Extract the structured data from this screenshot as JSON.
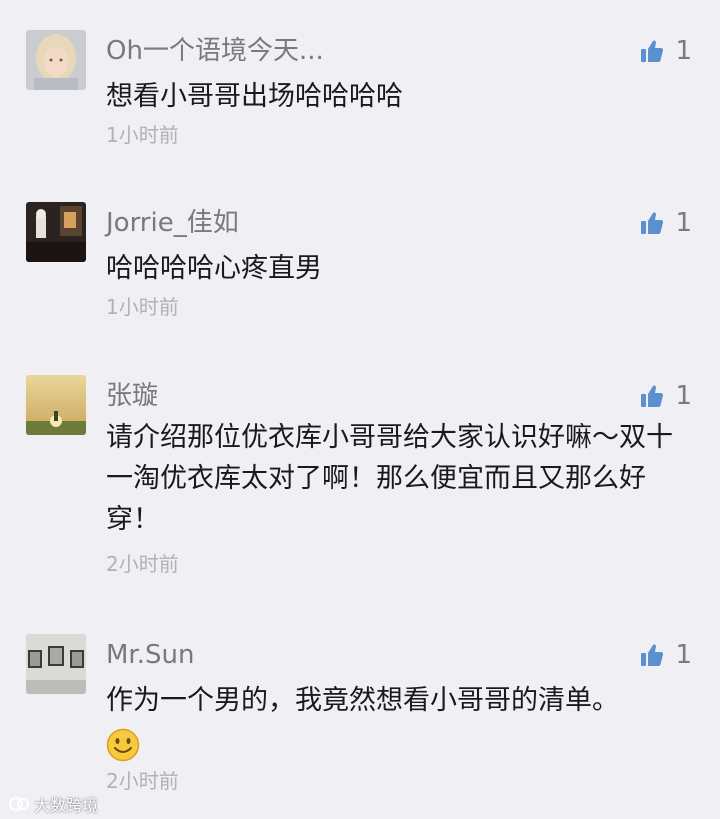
{
  "comments": [
    {
      "name": "Oh一个语境今天...",
      "text": "想看小哥哥出场哈哈哈哈",
      "time": "1小时前",
      "likes": "1",
      "avatar": "blonde-girl-avatar"
    },
    {
      "name": "Jorrie_佳如",
      "text": "哈哈哈哈心疼直男",
      "time": "1小时前",
      "likes": "1",
      "avatar": "dark-room-avatar"
    },
    {
      "name": "张璇",
      "text": "请介绍那位优衣库小哥哥给大家认识好嘛～双十一淘优衣库太对了啊！那么便宜而且又那么好穿！",
      "time": "2小时前",
      "likes": "1",
      "avatar": "sunset-avatar"
    },
    {
      "name": "Mr.Sun",
      "text": "作为一个男的，我竟然想看小哥哥的清单。",
      "time": "2小时前",
      "likes": "1",
      "avatar": "gallery-wall-avatar",
      "emoji": "smile-emoji"
    }
  ],
  "watermark": {
    "text": "大数跨境"
  },
  "colors": {
    "thumb": "#5a8fd0",
    "name": "#7a7a7a",
    "text": "#1a1a1a",
    "time": "#b2b2b2",
    "background": "#efeff4"
  }
}
